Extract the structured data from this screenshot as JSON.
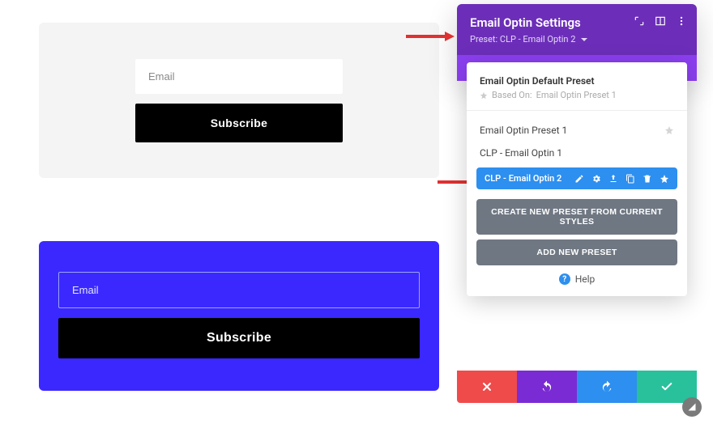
{
  "preview": {
    "light": {
      "email_placeholder": "Email",
      "subscribe": "Subscribe"
    },
    "blue": {
      "email_placeholder": "Email",
      "subscribe": "Subscribe"
    }
  },
  "panel": {
    "title": "Email Optin Settings",
    "preset_label_prefix": "Preset: ",
    "preset_current": "CLP - Email Optin 2"
  },
  "presets": {
    "default_title": "Email Optin Default Preset",
    "based_on_prefix": "Based On: ",
    "based_on": "Email Optin Preset 1",
    "items": [
      {
        "name": "Email Optin Preset 1",
        "starred": true
      },
      {
        "name": "CLP - Email Optin 1",
        "starred": false
      }
    ],
    "active": {
      "name": "CLP - Email Optin 2"
    },
    "btn_create": "CREATE NEW PRESET FROM CURRENT STYLES",
    "btn_add": "ADD NEW PRESET",
    "help": "Help"
  },
  "colors": {
    "panel_header": "#6c2eb9",
    "panel_strip": "#8b3ff0",
    "active_preset": "#2d8fef",
    "blue_card": "#3b28ff"
  }
}
